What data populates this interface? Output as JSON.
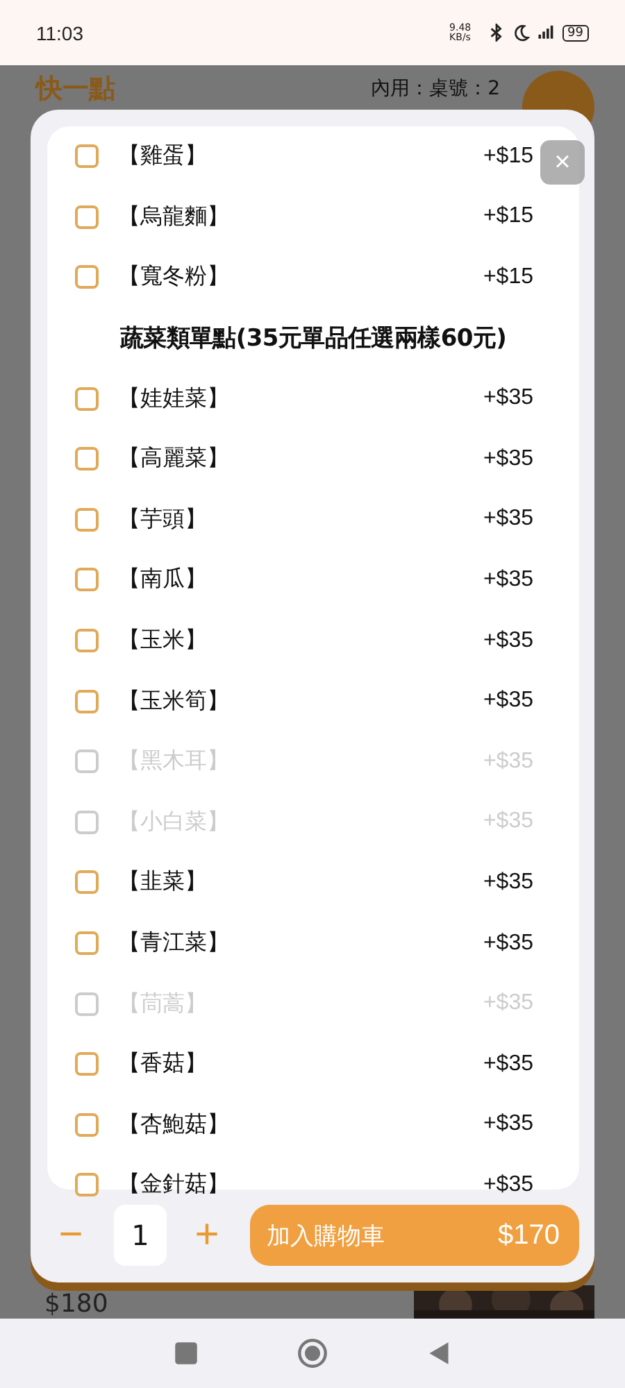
{
  "status_bar": {
    "time": "11:03",
    "speed": "9.48 KB/s",
    "battery": "99"
  },
  "background": {
    "logo": "快一點",
    "table_info": "內用：桌號：2",
    "price": "$180"
  },
  "modal": {
    "close": "×",
    "items": [
      {
        "kind": "option",
        "name": "【雞蛋】",
        "price": "+$15",
        "checked": false,
        "disabled": false
      },
      {
        "kind": "option",
        "name": "【烏龍麵】",
        "price": "+$15",
        "checked": false,
        "disabled": false
      },
      {
        "kind": "option",
        "name": "【寬冬粉】",
        "price": "+$15",
        "checked": false,
        "disabled": false
      },
      {
        "kind": "heading",
        "name": "蔬菜類單點(35元單品任選兩樣60元)"
      },
      {
        "kind": "option",
        "name": "【娃娃菜】",
        "price": "+$35",
        "checked": false,
        "disabled": false
      },
      {
        "kind": "option",
        "name": "【高麗菜】",
        "price": "+$35",
        "checked": false,
        "disabled": false
      },
      {
        "kind": "option",
        "name": "【芋頭】",
        "price": "+$35",
        "checked": false,
        "disabled": false
      },
      {
        "kind": "option",
        "name": "【南瓜】",
        "price": "+$35",
        "checked": false,
        "disabled": false
      },
      {
        "kind": "option",
        "name": "【玉米】",
        "price": "+$35",
        "checked": false,
        "disabled": false
      },
      {
        "kind": "option",
        "name": "【玉米筍】",
        "price": "+$35",
        "checked": false,
        "disabled": false
      },
      {
        "kind": "option",
        "name": "【黑木耳】",
        "price": "+$35",
        "checked": false,
        "disabled": true
      },
      {
        "kind": "option",
        "name": "【小白菜】",
        "price": "+$35",
        "checked": false,
        "disabled": true
      },
      {
        "kind": "option",
        "name": "【韭菜】",
        "price": "+$35",
        "checked": false,
        "disabled": false
      },
      {
        "kind": "option",
        "name": "【青江菜】",
        "price": "+$35",
        "checked": false,
        "disabled": false
      },
      {
        "kind": "option",
        "name": "【茼蒿】",
        "price": "+$35",
        "checked": false,
        "disabled": true
      },
      {
        "kind": "option",
        "name": "【香菇】",
        "price": "+$35",
        "checked": false,
        "disabled": false
      },
      {
        "kind": "option",
        "name": "【杏鮑菇】",
        "price": "+$35",
        "checked": false,
        "disabled": false
      },
      {
        "kind": "option",
        "name": "【金針菇】",
        "price": "+$35",
        "checked": false,
        "disabled": false
      }
    ],
    "minus": "−",
    "quantity": "1",
    "plus": "+",
    "add_button": {
      "label": "加入購物車",
      "total": "$170"
    }
  }
}
